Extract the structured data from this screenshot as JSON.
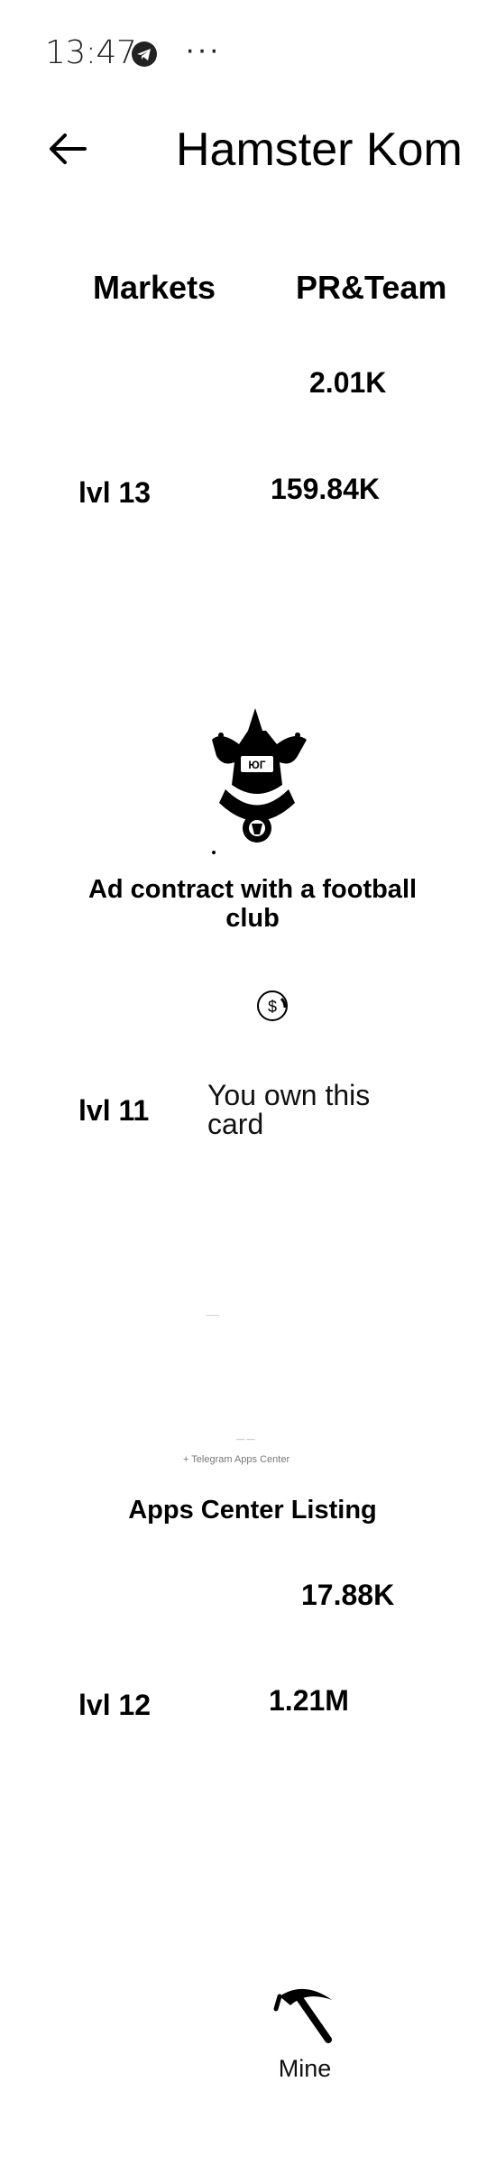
{
  "status_bar": {
    "time": "13:47",
    "more": "···"
  },
  "header": {
    "title": "Hamster Kom"
  },
  "tabs": [
    {
      "label": "Markets"
    },
    {
      "label": "PR&Team"
    }
  ],
  "rows": {
    "top_value": "2.01K",
    "top_level": "lvl 13",
    "top_level_value": "159.84K"
  },
  "card_1": {
    "title": "Ad contract with a football club",
    "level": "lvl 11",
    "status": "You own this card"
  },
  "card_2": {
    "faint_top": "-----",
    "faint_mid": "— —",
    "faint_caption": "+ Telegram Apps Center",
    "title": "Apps Center Listing",
    "value": "17.88K",
    "level": "lvl 12",
    "level_value": "1.21M"
  },
  "bottom_nav": {
    "mine_label": "Mine"
  },
  "icons": {
    "telegram": "telegram-icon",
    "back": "back-arrow-icon",
    "coin": "dollar-coin-icon",
    "mine": "pickaxe-icon",
    "football_club": "football-club-crest-image"
  }
}
